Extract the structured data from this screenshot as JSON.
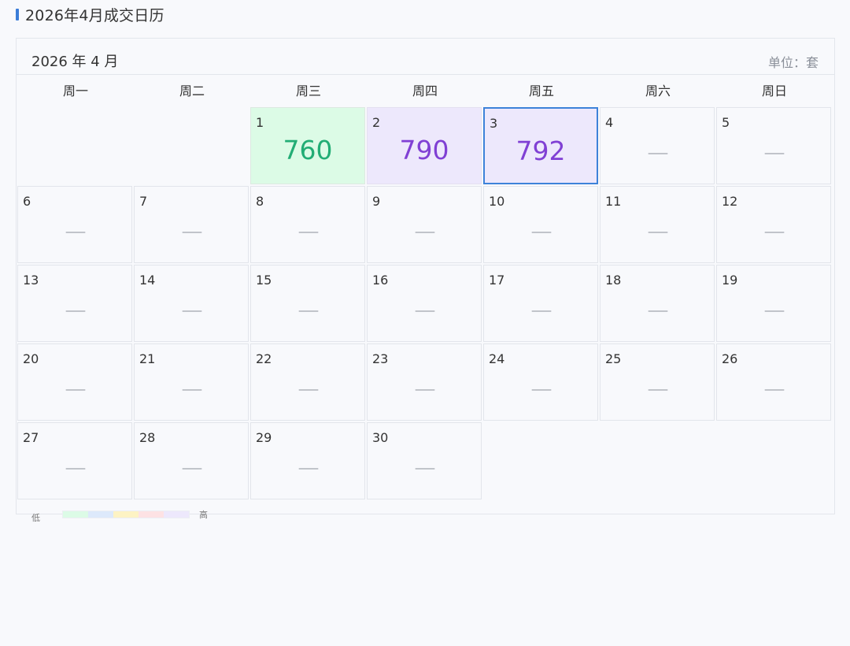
{
  "page": {
    "title": "2026年4月成交日历"
  },
  "calendar": {
    "month_label": "2026 年 4 月",
    "unit_label": "单位：套",
    "weekdays": [
      "周一",
      "周二",
      "周三",
      "周四",
      "周五",
      "周六",
      "周日"
    ],
    "empty_value": "——",
    "days": [
      {
        "day": "1",
        "col": 2,
        "row": 0,
        "value": "760",
        "level": "green"
      },
      {
        "day": "2",
        "col": 3,
        "row": 0,
        "value": "790",
        "level": "purple"
      },
      {
        "day": "3",
        "col": 4,
        "row": 0,
        "value": "792",
        "level": "purple",
        "selected": true
      },
      {
        "day": "4",
        "col": 5,
        "row": 0
      },
      {
        "day": "5",
        "col": 6,
        "row": 0
      },
      {
        "day": "6",
        "col": 0,
        "row": 1
      },
      {
        "day": "7",
        "col": 1,
        "row": 1
      },
      {
        "day": "8",
        "col": 2,
        "row": 1
      },
      {
        "day": "9",
        "col": 3,
        "row": 1
      },
      {
        "day": "10",
        "col": 4,
        "row": 1
      },
      {
        "day": "11",
        "col": 5,
        "row": 1
      },
      {
        "day": "12",
        "col": 6,
        "row": 1
      },
      {
        "day": "13",
        "col": 0,
        "row": 2
      },
      {
        "day": "14",
        "col": 1,
        "row": 2
      },
      {
        "day": "15",
        "col": 2,
        "row": 2
      },
      {
        "day": "16",
        "col": 3,
        "row": 2
      },
      {
        "day": "17",
        "col": 4,
        "row": 2
      },
      {
        "day": "18",
        "col": 5,
        "row": 2
      },
      {
        "day": "19",
        "col": 6,
        "row": 2
      },
      {
        "day": "20",
        "col": 0,
        "row": 3
      },
      {
        "day": "21",
        "col": 1,
        "row": 3
      },
      {
        "day": "22",
        "col": 2,
        "row": 3
      },
      {
        "day": "23",
        "col": 3,
        "row": 3
      },
      {
        "day": "24",
        "col": 4,
        "row": 3
      },
      {
        "day": "25",
        "col": 5,
        "row": 3
      },
      {
        "day": "26",
        "col": 6,
        "row": 3
      },
      {
        "day": "27",
        "col": 0,
        "row": 4
      },
      {
        "day": "28",
        "col": 1,
        "row": 4
      },
      {
        "day": "29",
        "col": 2,
        "row": 4
      },
      {
        "day": "30",
        "col": 3,
        "row": 4
      }
    ]
  },
  "legend": {
    "low_label": "低",
    "high_label": "高",
    "colors": [
      "#dcfbe6",
      "#dde9fb",
      "#fdf3c4",
      "#fde2e4",
      "#ede8fc"
    ]
  }
}
